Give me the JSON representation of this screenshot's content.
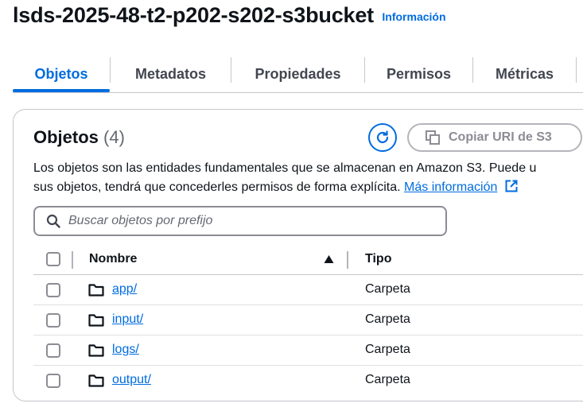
{
  "header": {
    "bucket_name": "lsds-2025-48-t2-p202-s202-s3bucket",
    "info_link": "Información"
  },
  "tabs": [
    {
      "label": "Objetos",
      "active": true
    },
    {
      "label": "Metadatos",
      "active": false
    },
    {
      "label": "Propiedades",
      "active": false
    },
    {
      "label": "Permisos",
      "active": false
    },
    {
      "label": "Métricas",
      "active": false
    }
  ],
  "objects_panel": {
    "title": "Objetos",
    "count": "(4)",
    "copy_uri_label": "Copiar URI de S3",
    "description_line1": "Los objetos son las entidades fundamentales que se almacenan en Amazon S3. Puede u",
    "description_line2": "sus objetos, tendrá que concederles permisos de forma explícita.",
    "more_info_link": "Más información",
    "search_placeholder": "Buscar objetos por prefijo",
    "search_value": ""
  },
  "table": {
    "columns": [
      "Nombre",
      "Tipo"
    ],
    "rows": [
      {
        "name": "app/",
        "type": "Carpeta"
      },
      {
        "name": "input/",
        "type": "Carpeta"
      },
      {
        "name": "logs/",
        "type": "Carpeta"
      },
      {
        "name": "output/",
        "type": "Carpeta"
      }
    ]
  },
  "colors": {
    "accent": "#006ce0",
    "text": "#0f141a",
    "border": "#c6c6cd"
  },
  "icons": [
    "refresh-icon",
    "copy-icon",
    "search-icon",
    "external-link-icon",
    "sort-ascending-icon",
    "folder-icon"
  ]
}
